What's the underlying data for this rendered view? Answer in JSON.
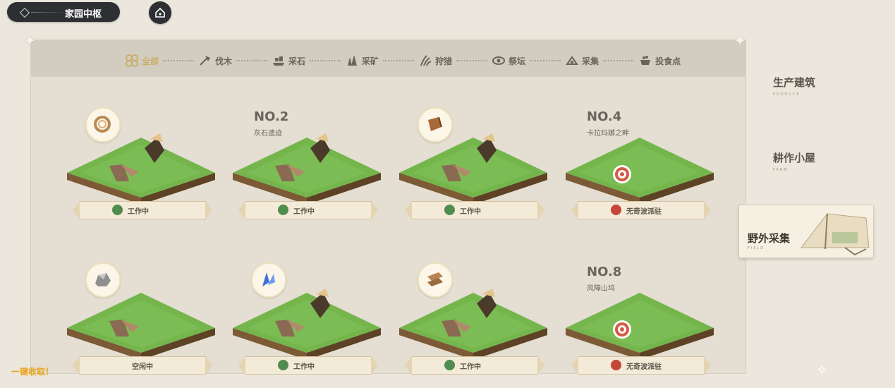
{
  "topbar": {
    "title": "家园中枢",
    "home_icon": "home-icon"
  },
  "tabs": [
    {
      "label": "全部",
      "icon": "clover-icon",
      "active": true
    },
    {
      "label": "伐木",
      "icon": "axe-icon",
      "active": false
    },
    {
      "label": "采石",
      "icon": "stone-icon",
      "active": false
    },
    {
      "label": "采矿",
      "icon": "crystal-icon",
      "active": false
    },
    {
      "label": "狩猎",
      "icon": "claw-icon",
      "active": false
    },
    {
      "label": "祭坛",
      "icon": "eye-icon",
      "active": false
    },
    {
      "label": "采集",
      "icon": "gather-icon",
      "active": false
    },
    {
      "label": "投食点",
      "icon": "feed-icon",
      "active": false
    }
  ],
  "sidebar": {
    "items": [
      {
        "label": "生产建筑",
        "sub": "PRODUCE"
      },
      {
        "label": "耕作小屋",
        "sub": "FARM"
      },
      {
        "label": "野外采集",
        "sub": "FIELD",
        "active": true
      }
    ]
  },
  "cards": [
    {
      "no": "",
      "place": "",
      "resource": "rope-icon",
      "status": "工作中",
      "status_type": "working"
    },
    {
      "no": "NO.2",
      "place": "灰石遗迹",
      "resource": "",
      "status": "工作中",
      "status_type": "working"
    },
    {
      "no": "",
      "place": "",
      "resource": "wood-icon",
      "status": "工作中",
      "status_type": "working"
    },
    {
      "no": "NO.4",
      "place": "卡拉玛娜之畔",
      "resource": "",
      "status": "无奇波派驻",
      "status_type": "empty"
    },
    {
      "no": "",
      "place": "",
      "resource": "rock-icon",
      "status": "空闲中",
      "status_type": "idle"
    },
    {
      "no": "",
      "place": "",
      "resource": "blue-crystal-icon",
      "status": "工作中",
      "status_type": "working"
    },
    {
      "no": "",
      "place": "",
      "resource": "plank-icon",
      "status": "工作中",
      "status_type": "working"
    },
    {
      "no": "NO.8",
      "place": "风障山坞",
      "resource": "",
      "status": "无奇波派驻",
      "status_type": "empty"
    }
  ],
  "harvest_label": "一键收取！",
  "colors": {
    "accent": "#c9ad6a",
    "working": "#4f8c4e",
    "empty": "#c54536",
    "grass": "#6fb04a"
  }
}
